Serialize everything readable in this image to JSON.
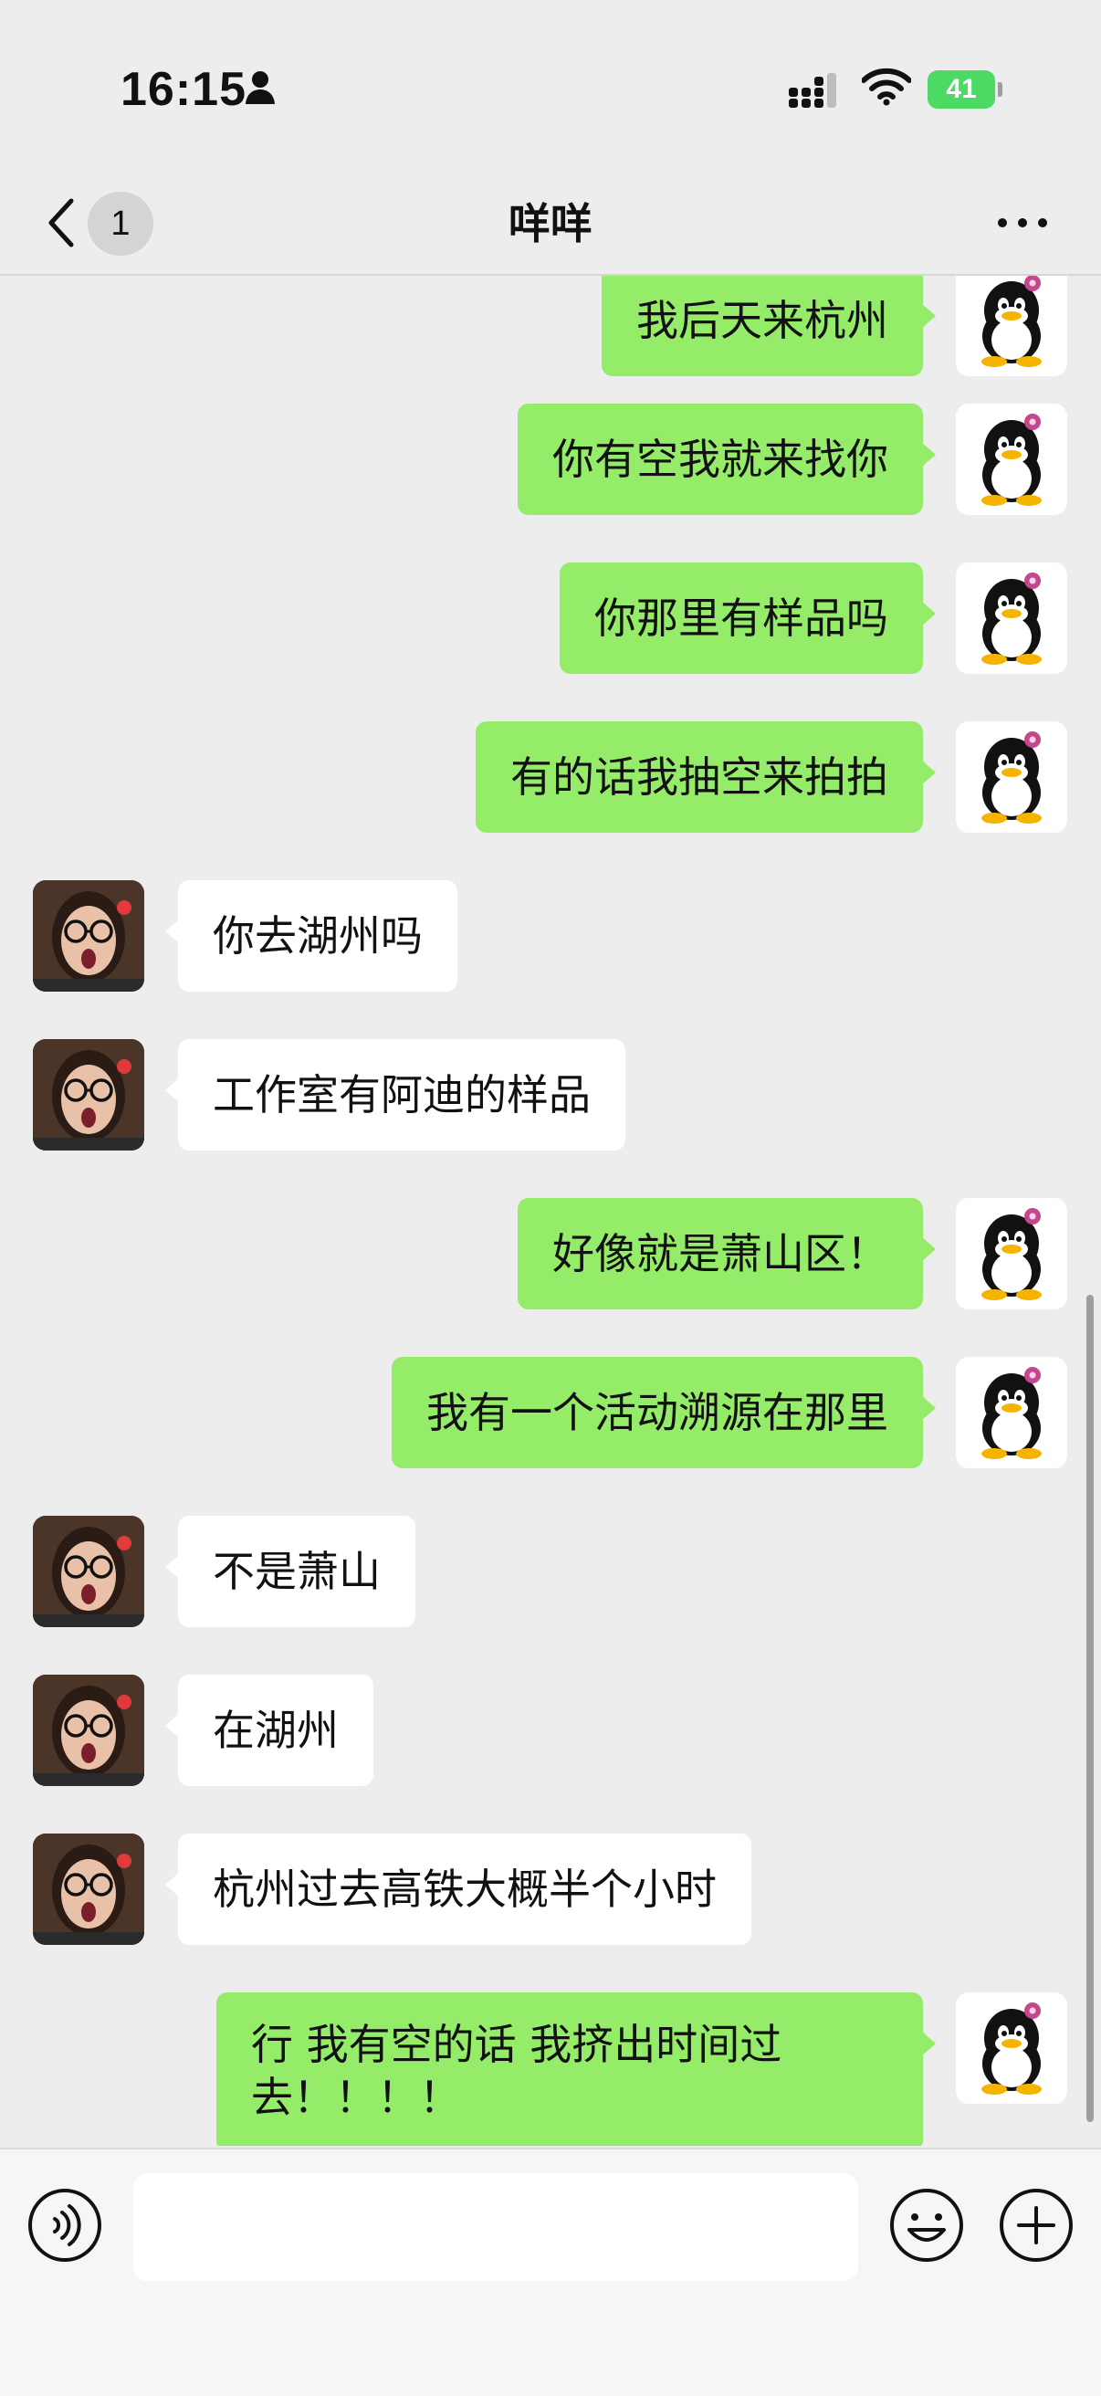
{
  "status_bar": {
    "time": "16:15",
    "battery": "41",
    "icons": [
      "person-icon",
      "signal-icon",
      "wifi-icon",
      "battery-icon"
    ]
  },
  "header": {
    "back_badge": "1",
    "title": "咩咩",
    "icons": [
      "chevron-left-icon",
      "more-icon"
    ]
  },
  "messages": [
    {
      "from": "me",
      "text": "我后天来杭州"
    },
    {
      "from": "me",
      "text": "你有空我就来找你"
    },
    {
      "from": "me",
      "text": "你那里有样品吗"
    },
    {
      "from": "me",
      "text": "有的话我抽空来拍拍"
    },
    {
      "from": "peer",
      "text": "你去湖州吗"
    },
    {
      "from": "peer",
      "text": "工作室有阿迪的样品"
    },
    {
      "from": "me",
      "text": "好像就是萧山区！"
    },
    {
      "from": "me",
      "text": "我有一个活动溯源在那里"
    },
    {
      "from": "peer",
      "text": "不是萧山"
    },
    {
      "from": "peer",
      "text": "在湖州"
    },
    {
      "from": "peer",
      "text": "杭州过去高铁大概半个小时"
    },
    {
      "from": "me",
      "text": "行 我有空的话 我挤出时间过去！！！！"
    }
  ],
  "input_bar": {
    "text": "",
    "icons": [
      "voice-icon",
      "emoji-icon",
      "plus-icon"
    ]
  },
  "colors": {
    "my_bubble": "#95ec69",
    "peer_bubble": "#ffffff",
    "background": "#ededed",
    "battery": "#4cd964"
  }
}
